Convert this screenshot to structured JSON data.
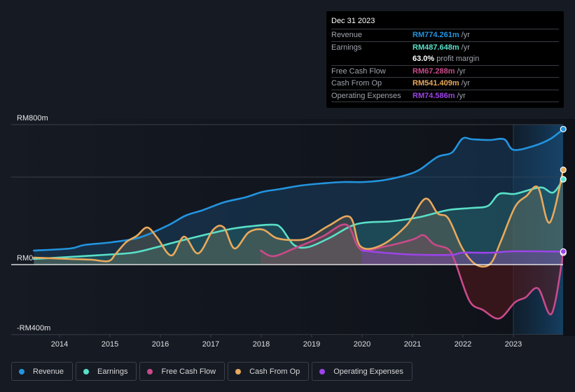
{
  "tooltip": {
    "date": "Dec 31 2023",
    "rows": [
      {
        "label": "Revenue",
        "value": "RM774.261m",
        "unit": "/yr",
        "color": "#2394df"
      },
      {
        "label": "Earnings",
        "value": "RM487.648m",
        "unit": "/yr",
        "color": "#59e0c9"
      },
      {
        "label": "",
        "value": "63.0%",
        "unit": "profit margin",
        "color": "#ffffff"
      },
      {
        "label": "Free Cash Flow",
        "value": "RM67.288m",
        "unit": "/yr",
        "color": "#c94a8a"
      },
      {
        "label": "Cash From Op",
        "value": "RM541.409m",
        "unit": "/yr",
        "color": "#e8a95c"
      },
      {
        "label": "Operating Expenses",
        "value": "RM74.586m",
        "unit": "/yr",
        "color": "#9c44e8"
      }
    ]
  },
  "legend": [
    {
      "label": "Revenue",
      "color": "#2394df"
    },
    {
      "label": "Earnings",
      "color": "#59e0c9"
    },
    {
      "label": "Free Cash Flow",
      "color": "#c94a8a"
    },
    {
      "label": "Cash From Op",
      "color": "#e8a95c"
    },
    {
      "label": "Operating Expenses",
      "color": "#9c44e8"
    }
  ],
  "chart_data": {
    "type": "area",
    "title": "",
    "xlabel": "",
    "ylabel": "",
    "y_unit": "RM millions",
    "ylim": [
      -400,
      800
    ],
    "xlim": [
      2013.49,
      2023.99
    ],
    "y_tick_labels": [
      {
        "value": 800,
        "label": "RM800m"
      },
      {
        "value": 0,
        "label": "RM0"
      },
      {
        "value": -400,
        "label": "-RM400m"
      }
    ],
    "gridlines": [
      800,
      500,
      0
    ],
    "x_ticks": [
      2014,
      2015,
      2016,
      2017,
      2018,
      2019,
      2020,
      2021,
      2022,
      2023
    ],
    "x_tick_labels": [
      "2014",
      "2015",
      "2016",
      "2017",
      "2018",
      "2019",
      "2020",
      "2021",
      "2022",
      "2023"
    ],
    "highlight_region_start": 2023.0,
    "legend_position": "bottom-left",
    "series": [
      {
        "name": "Revenue",
        "color": "#2394df",
        "x": [
          2013.49,
          2014.21,
          2014.49,
          2015.04,
          2015.6,
          2016.15,
          2016.5,
          2016.85,
          2017.26,
          2017.68,
          2018.03,
          2018.38,
          2018.79,
          2019.21,
          2019.63,
          2020.04,
          2020.46,
          2020.88,
          2021.15,
          2021.5,
          2021.78,
          2021.99,
          2022.19,
          2022.54,
          2022.82,
          2023.0,
          2023.38,
          2023.72,
          2023.99
        ],
        "values": [
          80,
          92,
          112,
          128,
          156,
          224,
          280,
          312,
          356,
          384,
          416,
          432,
          452,
          464,
          472,
          472,
          484,
          512,
          544,
          616,
          640,
          720,
          716,
          712,
          716,
          656,
          676,
          716,
          774.261
        ]
      },
      {
        "name": "Earnings",
        "color": "#59e0c9",
        "x": [
          2013.49,
          2014.21,
          2014.9,
          2015.46,
          2015.88,
          2016.29,
          2016.85,
          2017.4,
          2017.82,
          2018.24,
          2018.4,
          2018.65,
          2018.93,
          2019.35,
          2019.9,
          2020.6,
          2021.15,
          2021.71,
          2022.19,
          2022.5,
          2022.72,
          2023.03,
          2023.38,
          2023.58,
          2023.79,
          2023.99
        ],
        "values": [
          32,
          44,
          56,
          68,
          96,
          128,
          168,
          204,
          220,
          228,
          208,
          112,
          100,
          152,
          232,
          248,
          272,
          312,
          324,
          336,
          404,
          404,
          432,
          440,
          412,
          487.648
        ]
      },
      {
        "name": "Free Cash Flow",
        "color": "#c94a8a",
        "x": [
          2017.99,
          2018.24,
          2018.65,
          2019.21,
          2019.69,
          2019.97,
          2020.46,
          2021.01,
          2021.22,
          2021.43,
          2021.71,
          2021.85,
          2022.13,
          2022.4,
          2022.72,
          2023.03,
          2023.24,
          2023.49,
          2023.76,
          2023.99
        ],
        "values": [
          80,
          48,
          92,
          160,
          228,
          88,
          104,
          144,
          168,
          116,
          88,
          12,
          -208,
          -260,
          -308,
          -216,
          -188,
          -136,
          -280,
          67.288
        ]
      },
      {
        "name": "Cash From Op",
        "color": "#e8a95c",
        "x": [
          2013.49,
          2014.21,
          2014.63,
          2014.97,
          2015.11,
          2015.32,
          2015.53,
          2015.74,
          2015.94,
          2016.22,
          2016.47,
          2016.75,
          2017.05,
          2017.26,
          2017.47,
          2017.75,
          2018.03,
          2018.3,
          2018.65,
          2018.93,
          2019.35,
          2019.76,
          2019.97,
          2020.39,
          2020.88,
          2021.25,
          2021.5,
          2021.71,
          2021.99,
          2022.26,
          2022.54,
          2022.75,
          2023.03,
          2023.26,
          2023.49,
          2023.72,
          2023.99
        ],
        "values": [
          40,
          32,
          28,
          20,
          60,
          128,
          164,
          212,
          152,
          52,
          160,
          64,
          200,
          212,
          92,
          184,
          200,
          152,
          140,
          152,
          224,
          272,
          104,
          112,
          224,
          376,
          292,
          264,
          92,
          0,
          4,
          132,
          328,
          392,
          440,
          240,
          541.409
        ]
      },
      {
        "name": "Operating Expenses",
        "color": "#9c44e8",
        "x": [
          2019.99,
          2020.6,
          2021.15,
          2021.78,
          2021.99,
          2022.54,
          2023.0,
          2023.99
        ],
        "values": [
          80,
          64,
          56,
          56,
          68,
          68,
          76,
          74.586
        ]
      }
    ]
  }
}
